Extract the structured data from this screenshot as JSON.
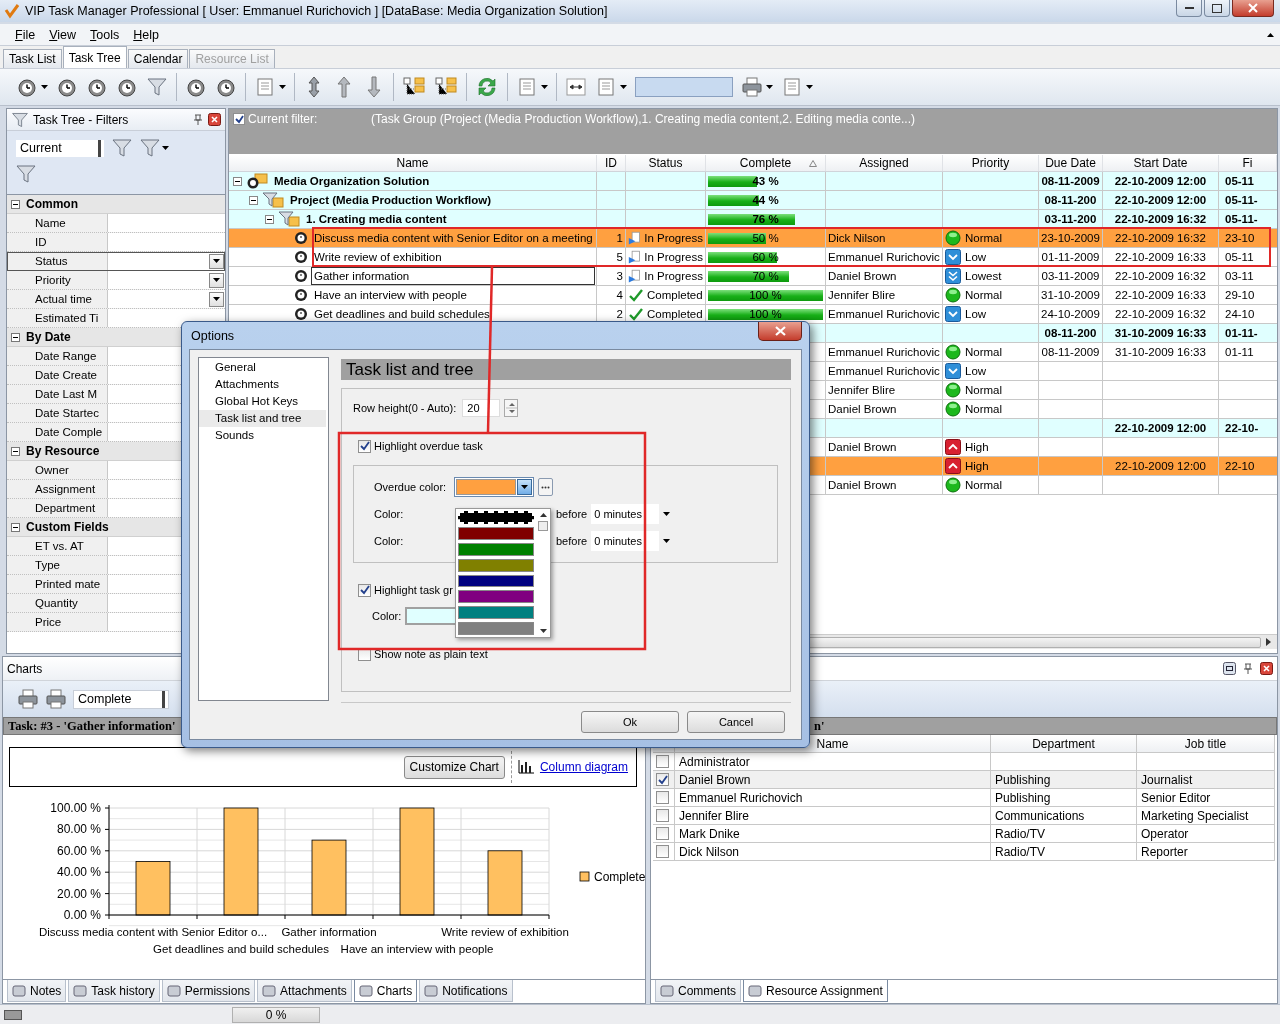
{
  "window": {
    "title": "VIP Task Manager Professional [ User: Emmanuel Rurichovich ] [DataBase: Media Organization Solution]"
  },
  "menu": [
    "File",
    "View",
    "Tools",
    "Help"
  ],
  "tabs": [
    {
      "label": "Task List",
      "selected": false,
      "disabled": false
    },
    {
      "label": "Task Tree",
      "selected": true,
      "disabled": false
    },
    {
      "label": "Calendar",
      "selected": false,
      "disabled": false
    },
    {
      "label": "Resource List",
      "selected": false,
      "disabled": true
    }
  ],
  "filters_panel": {
    "title": "Task Tree - Filters",
    "preset": "Current",
    "sections": [
      {
        "label": "Common",
        "expanded": true,
        "fields": [
          {
            "label": "Name",
            "kind": "text",
            "selected": false
          },
          {
            "label": "ID",
            "kind": "text",
            "selected": false
          },
          {
            "label": "Status",
            "kind": "dropdown",
            "selected": true
          },
          {
            "label": "Priority",
            "kind": "dropdown",
            "selected": false
          },
          {
            "label": "Actual time",
            "kind": "dropdown",
            "selected": false
          },
          {
            "label": "Estimated Ti",
            "kind": "text",
            "selected": false
          }
        ]
      },
      {
        "label": "By Date",
        "expanded": true,
        "fields": [
          {
            "label": "Date Range",
            "kind": "text",
            "selected": false
          },
          {
            "label": "Date Create",
            "kind": "text",
            "selected": false
          },
          {
            "label": "Date Last M",
            "kind": "text",
            "selected": false
          },
          {
            "label": "Date Startec",
            "kind": "text",
            "selected": false
          },
          {
            "label": "Date Comple",
            "kind": "text",
            "selected": false
          }
        ]
      },
      {
        "label": "By Resource",
        "expanded": true,
        "fields": [
          {
            "label": "Owner",
            "kind": "text",
            "selected": false
          },
          {
            "label": "Assignment",
            "kind": "text",
            "selected": false
          },
          {
            "label": "Department",
            "kind": "text",
            "selected": false
          }
        ]
      },
      {
        "label": "Custom Fields",
        "expanded": true,
        "fields": [
          {
            "label": "ET vs. AT",
            "kind": "text",
            "selected": false
          },
          {
            "label": "Type",
            "kind": "text",
            "selected": false
          },
          {
            "label": "Printed mate",
            "kind": "text",
            "selected": false
          },
          {
            "label": "Quantity",
            "kind": "text",
            "selected": false
          },
          {
            "label": "Price",
            "kind": "text",
            "selected": false
          }
        ]
      }
    ]
  },
  "filter_bar": {
    "enabled": true,
    "label": "Current filter:",
    "expression": "(Task Group  (Project (Media Production Workflow),1. Creating media content,2. Editing media conte...)"
  },
  "task_grid": {
    "columns": [
      {
        "label": "Name",
        "sorted": false
      },
      {
        "label": "ID",
        "sorted": false
      },
      {
        "label": "Status",
        "sorted": false
      },
      {
        "label": "Complete",
        "sorted": true
      },
      {
        "label": "Assigned",
        "sorted": false
      },
      {
        "label": "Priority",
        "sorted": false
      },
      {
        "label": "Due Date",
        "sorted": false
      },
      {
        "label": "Start Date",
        "sorted": false
      },
      {
        "label": "Fi",
        "sorted": false
      }
    ],
    "rows": [
      {
        "kind": "group",
        "name": "Media Organization Solution",
        "expanded": true,
        "selected": false,
        "overdue": false,
        "level": 0.43,
        "complete": "43 %",
        "due": "08-11-2009",
        "start": "22-10-2009 12:00",
        "finish": "05-11",
        "children": [
          {
            "kind": "group",
            "name": "Project (Media Production Workflow)",
            "expanded": true,
            "selected": false,
            "overdue": false,
            "level": 0.44,
            "complete": "44 %",
            "due": "08-11-200",
            "start": "22-10-2009 12:00",
            "finish": "05-11-",
            "children": [
              {
                "kind": "group",
                "name": "1. Creating media content",
                "expanded": true,
                "selected": false,
                "overdue": false,
                "level": 0.76,
                "complete": "76 %",
                "due": "03-11-200",
                "start": "22-10-2009 16:32",
                "finish": "05-11-",
                "children": [
                  {
                    "kind": "task",
                    "name": "Discuss media content with Senior Editor on a meeting",
                    "id": "1",
                    "status": {
                      "label": "In Progress",
                      "kind": "progress"
                    },
                    "level": 0.5,
                    "complete": "50 %",
                    "assigned": "Dick Nilson",
                    "priority": {
                      "label": "Normal",
                      "kind": "normal"
                    },
                    "due": "23-10-2009",
                    "start": "22-10-2009 16:32",
                    "finish": "23-10",
                    "selected": false,
                    "overdue": true
                  },
                  {
                    "kind": "task",
                    "name": "Write review of exhibition",
                    "id": "5",
                    "status": {
                      "label": "In Progress",
                      "kind": "progress"
                    },
                    "level": 0.6,
                    "complete": "60 %",
                    "assigned": "Emmanuel Rurichovic",
                    "priority": {
                      "label": "Low",
                      "kind": "low"
                    },
                    "due": "01-11-2009",
                    "start": "22-10-2009 16:33",
                    "finish": "05-11",
                    "selected": false,
                    "overdue": false
                  },
                  {
                    "kind": "task",
                    "name": "Gather information",
                    "id": "3",
                    "status": {
                      "label": "In Progress",
                      "kind": "progress"
                    },
                    "level": 0.7,
                    "complete": "70 %",
                    "assigned": "Daniel Brown",
                    "priority": {
                      "label": "Lowest",
                      "kind": "lowest"
                    },
                    "due": "03-11-2009",
                    "start": "22-10-2009 16:32",
                    "finish": "03-11",
                    "selected": true,
                    "overdue": false
                  },
                  {
                    "kind": "task",
                    "name": "Have an interview with people",
                    "id": "4",
                    "status": {
                      "label": "Completed",
                      "kind": "done"
                    },
                    "level": 1,
                    "complete": "100 %",
                    "assigned": "Jennifer Blire",
                    "priority": {
                      "label": "Normal",
                      "kind": "normal"
                    },
                    "due": "31-10-2009",
                    "start": "22-10-2009 16:33",
                    "finish": "29-10",
                    "selected": false,
                    "overdue": false
                  },
                  {
                    "kind": "task",
                    "name": "Get deadlines and build schedules",
                    "id": "2",
                    "status": {
                      "label": "Completed",
                      "kind": "done"
                    },
                    "level": 1,
                    "complete": "100 %",
                    "assigned": "Emmanuel Rurichovic",
                    "priority": {
                      "label": "Low",
                      "kind": "low"
                    },
                    "due": "24-10-2009",
                    "start": "22-10-2009 16:32",
                    "finish": "24-10",
                    "selected": false,
                    "overdue": false
                  }
                ]
              },
              {
                "kind": "group",
                "overdue": false,
                "due": "08-11-200",
                "start": "31-10-2009 16:33",
                "finish": "01-11-",
                "children": [
                  {
                    "kind": "task",
                    "assigned": "Emmanuel Rurichovic",
                    "priority": {
                      "label": "Normal",
                      "kind": "normal"
                    },
                    "due": "08-11-2009",
                    "start": "31-10-2009 16:33",
                    "finish": "01-11",
                    "overdue": false
                  },
                  {
                    "kind": "task",
                    "assigned": "Emmanuel Rurichovic",
                    "priority": {
                      "label": "Low",
                      "kind": "low"
                    },
                    "overdue": false
                  },
                  {
                    "kind": "task",
                    "assigned": "Jennifer Blire",
                    "priority": {
                      "label": "Normal",
                      "kind": "normal"
                    },
                    "overdue": false
                  },
                  {
                    "kind": "task",
                    "assigned": "Daniel Brown",
                    "priority": {
                      "label": "Normal",
                      "kind": "normal"
                    },
                    "overdue": false
                  }
                ]
              },
              {
                "kind": "group",
                "overdue": false,
                "start": "22-10-2009 12:00",
                "finish": "22-10-",
                "children": [
                  {
                    "kind": "task",
                    "assigned": "Daniel Brown",
                    "priority": {
                      "label": "High",
                      "kind": "high"
                    },
                    "overdue": false
                  },
                  {
                    "kind": "task",
                    "priority": {
                      "label": "High",
                      "kind": "high"
                    },
                    "start": "22-10-2009 12:00",
                    "finish": "22-10",
                    "overdue": true
                  },
                  {
                    "kind": "task",
                    "assigned": "Daniel Brown",
                    "priority": {
                      "label": "Normal",
                      "kind": "normal"
                    },
                    "overdue": false
                  }
                ]
              }
            ]
          }
        ]
      }
    ]
  },
  "options_dialog": {
    "title": "Options",
    "pages": [
      {
        "label": "General",
        "selected": false
      },
      {
        "label": "Attachments",
        "selected": false
      },
      {
        "label": "Global Hot Keys",
        "selected": false
      },
      {
        "label": "Task list and tree",
        "selected": true
      },
      {
        "label": "Sounds",
        "selected": false
      }
    ],
    "heading": "Task list and tree",
    "row_height": {
      "label": "Row height(0 - Auto):",
      "value": "20"
    },
    "highlight_overdue": {
      "label": "Highlight overdue task",
      "checked": true
    },
    "overdue_color": {
      "label": "Overdue color:",
      "color": "#ffa040"
    },
    "reminder_rows": [
      {
        "label": "Color:",
        "before": "before",
        "value": "0 minutes"
      },
      {
        "label": "Color:",
        "before": "before",
        "value": "0 minutes"
      }
    ],
    "highlight_groups": {
      "label": "Highlight task gr",
      "checked": true
    },
    "group_color": {
      "label": "Color:",
      "color": "#e0ffff"
    },
    "plain_notes": {
      "label": "Show note as plain text",
      "checked": false
    },
    "color_list": [
      {
        "color": "#000000",
        "selected": true
      },
      {
        "color": "#800000",
        "selected": false
      },
      {
        "color": "#008000",
        "selected": false
      },
      {
        "color": "#808000",
        "selected": false
      },
      {
        "color": "#000080",
        "selected": false
      },
      {
        "color": "#800080",
        "selected": false
      },
      {
        "color": "#008080",
        "selected": false
      },
      {
        "color": "#808080",
        "selected": false
      }
    ],
    "buttons": [
      "Ok",
      "Cancel"
    ]
  },
  "charts_panel": {
    "title": "Charts",
    "metric": "Complete",
    "task_header": "Task: #3 - 'Gather information'",
    "customize_button": "Customize Chart",
    "diagram_link": "Column diagram",
    "chart_data": {
      "type": "bar",
      "grid": true,
      "categories": [
        "Discuss media content with Senior Editor o...",
        "Get deadlines and build schedules",
        "Gather information",
        "Have an interview with people",
        "Write review of exhibition"
      ],
      "series": [
        {
          "name": "Complete",
          "color": "#ffc060",
          "values": [
            50,
            100,
            70,
            100,
            60
          ]
        }
      ],
      "ylim": [
        0,
        100
      ],
      "yticks": [
        {
          "value": 0,
          "label": "0.00 %"
        },
        {
          "value": 20,
          "label": "20.00 %"
        },
        {
          "value": 40,
          "label": "40.00 %"
        },
        {
          "value": 60,
          "label": "60.00 %"
        },
        {
          "value": 80,
          "label": "80.00 %"
        },
        {
          "value": 100,
          "label": "100.00 %"
        }
      ]
    },
    "tabs": [
      {
        "label": "Notes",
        "selected": false
      },
      {
        "label": "Task history",
        "selected": false
      },
      {
        "label": "Permissions",
        "selected": false
      },
      {
        "label": "Attachments",
        "selected": false
      },
      {
        "label": "Charts",
        "selected": true
      },
      {
        "label": "Notifications",
        "selected": false
      }
    ]
  },
  "resource_panel": {
    "header": "n'",
    "columns": [
      "Name",
      "Department",
      "Job title"
    ],
    "rows": [
      {
        "checked": false,
        "name": "Administrator"
      },
      {
        "checked": true,
        "name": "Daniel Brown",
        "department": "Publishing",
        "job_title": "Journalist"
      },
      {
        "checked": false,
        "name": "Emmanuel Rurichovich",
        "department": "Publishing",
        "job_title": "Senior Editor"
      },
      {
        "checked": false,
        "name": "Jennifer Blire",
        "department": "Communications",
        "job_title": "Marketing Specialist"
      },
      {
        "checked": false,
        "name": "Mark Dnike",
        "department": "Radio/TV",
        "job_title": "Operator"
      },
      {
        "checked": false,
        "name": "Dick Nilson",
        "department": "Radio/TV",
        "job_title": "Reporter"
      }
    ],
    "tabs": [
      {
        "label": "Comments",
        "selected": false
      },
      {
        "label": "Resource Assignment",
        "selected": true
      }
    ]
  },
  "status_bar": {
    "progress": "0 %"
  }
}
